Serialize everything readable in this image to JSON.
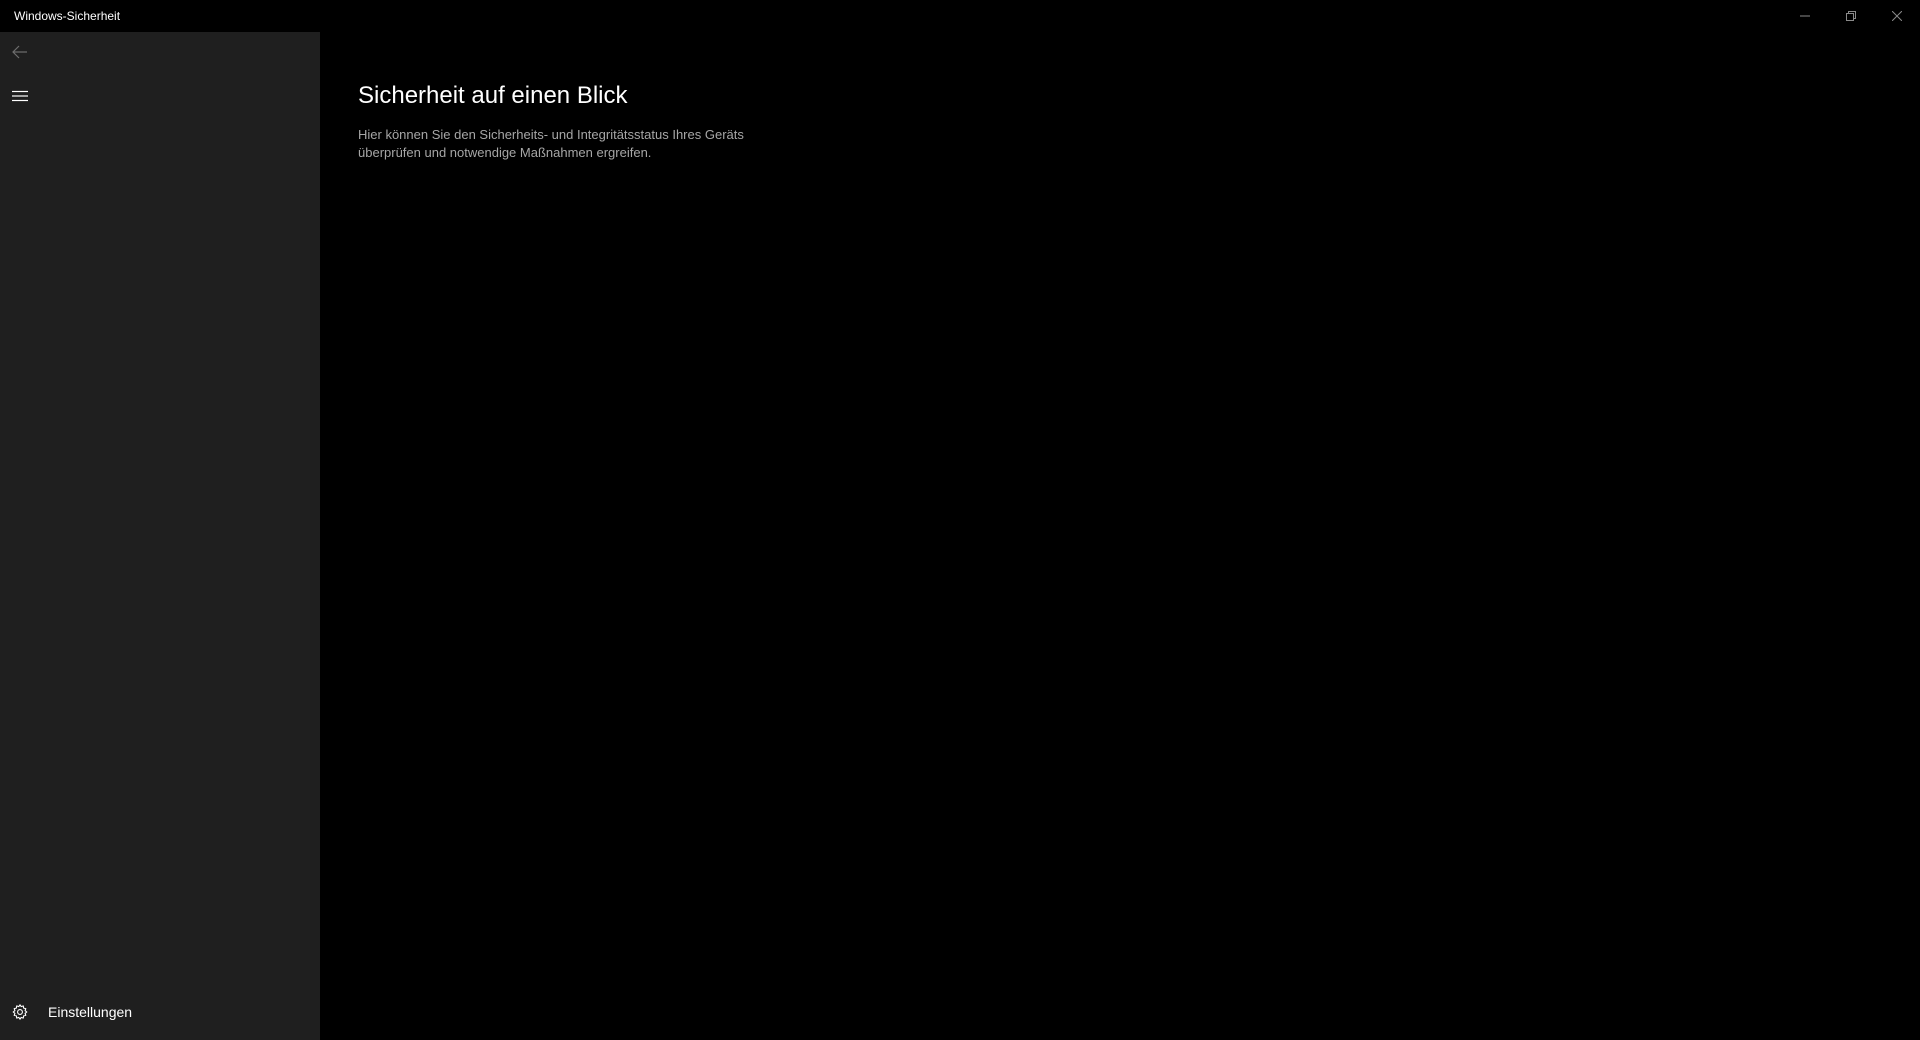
{
  "window": {
    "title": "Windows-Sicherheit"
  },
  "titlebar": {
    "minimize_icon": "minimize-icon",
    "maximize_icon": "restore-icon",
    "close_icon": "close-icon"
  },
  "sidebar": {
    "back_icon": "back-arrow-icon",
    "menu_icon": "hamburger-menu-icon",
    "settings": {
      "icon": "gear-icon",
      "label": "Einstellungen"
    }
  },
  "main": {
    "title": "Sicherheit auf einen Blick",
    "description": "Hier können Sie den Sicherheits- und Integritätsstatus Ihres Geräts überprüfen und notwendige Maßnahmen ergreifen."
  },
  "colors": {
    "background": "#000000",
    "sidebar": "#1f1f1f",
    "text_primary": "#ffffff",
    "text_secondary": "#a6a6a6"
  }
}
